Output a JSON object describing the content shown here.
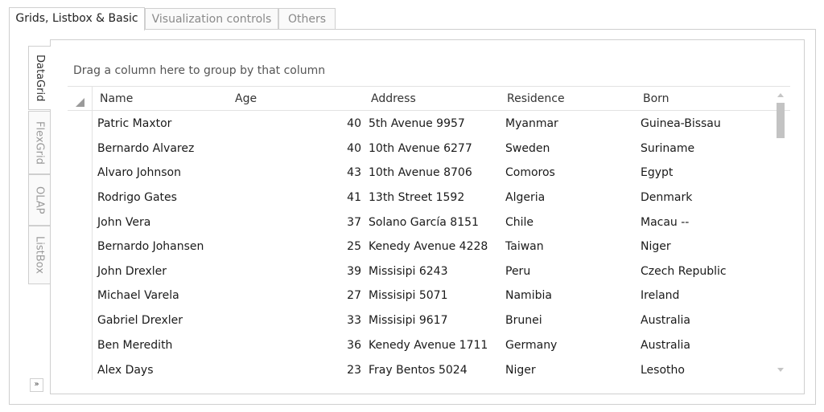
{
  "top_tabs": [
    "Grids, Listbox & Basic",
    "Visualization controls",
    "Others"
  ],
  "side_tabs": [
    "DataGrid",
    "FlexGrid",
    "OLAP",
    "ListBox"
  ],
  "expand_glyph": "»",
  "group_hint": "Drag a column here to group by that column",
  "columns": [
    "Name",
    "Age",
    "Address",
    "Residence",
    "Born"
  ],
  "rows": [
    {
      "name": "Patric Maxtor",
      "age": "40",
      "address": "5th Avenue 9957",
      "residence": "Myanmar",
      "born": "Guinea-Bissau"
    },
    {
      "name": "Bernardo Alvarez",
      "age": "40",
      "address": "10th Avenue 6277",
      "residence": "Sweden",
      "born": "Suriname"
    },
    {
      "name": "Alvaro Johnson",
      "age": "43",
      "address": "10th Avenue 8706",
      "residence": "Comoros",
      "born": "Egypt"
    },
    {
      "name": "Rodrigo Gates",
      "age": "41",
      "address": "13th Street 1592",
      "residence": "Algeria",
      "born": "Denmark"
    },
    {
      "name": "John Vera",
      "age": "37",
      "address": "Solano García 8151",
      "residence": "Chile",
      "born": "Macau --"
    },
    {
      "name": "Bernardo Johansen",
      "age": "25",
      "address": "Kenedy Avenue 4228",
      "residence": "Taiwan",
      "born": "Niger"
    },
    {
      "name": "John Drexler",
      "age": "39",
      "address": "Missisipi 6243",
      "residence": "Peru",
      "born": "Czech Republic"
    },
    {
      "name": "Michael Varela",
      "age": "27",
      "address": "Missisipi 5071",
      "residence": "Namibia",
      "born": "Ireland"
    },
    {
      "name": "Gabriel Drexler",
      "age": "33",
      "address": "Missisipi 9617",
      "residence": "Brunei",
      "born": "Australia"
    },
    {
      "name": "Ben Meredith",
      "age": "36",
      "address": "Kenedy Avenue 1711",
      "residence": "Germany",
      "born": "Australia"
    },
    {
      "name": "Alex Days",
      "age": "23",
      "address": "Fray Bentos 5024",
      "residence": "Niger",
      "born": "Lesotho"
    }
  ]
}
